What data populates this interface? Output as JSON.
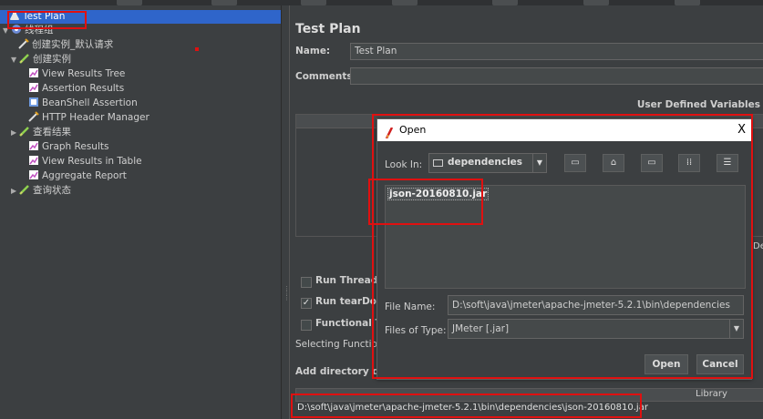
{
  "tree": {
    "items": [
      {
        "label": "Test Plan",
        "icon": "flask-icon"
      },
      {
        "label": "线程组",
        "icon": "gear-icon"
      },
      {
        "label": "创建实例_默认请求",
        "icon": "wrench-icon"
      },
      {
        "label": "创建实例",
        "icon": "pen-icon"
      },
      {
        "label": "View Results Tree",
        "icon": "chart-icon"
      },
      {
        "label": "Assertion Results",
        "icon": "chart-icon"
      },
      {
        "label": "BeanShell Assertion",
        "icon": "assert-icon"
      },
      {
        "label": "HTTP Header Manager",
        "icon": "wrench-icon"
      },
      {
        "label": "查看结果",
        "icon": "pen-icon"
      },
      {
        "label": "Graph Results",
        "icon": "chart-icon"
      },
      {
        "label": "View Results in Table",
        "icon": "chart-icon"
      },
      {
        "label": "Aggregate Report",
        "icon": "chart-icon"
      },
      {
        "label": "查询状态",
        "icon": "pen-icon"
      }
    ]
  },
  "panel": {
    "title": "Test Plan",
    "name_label": "Name:",
    "name_value": "Test Plan",
    "comments_label": "Comments:",
    "udv_label": "User Defined Variables",
    "run_thread_label": "Run Thread G",
    "run_teardown_label": "Run tearDown",
    "functional_label": "Functional Tes",
    "selecting_label": "Selecting Functiona",
    "add_dir_label": "Add directory or ja",
    "library_header": "Library",
    "classpath_entry": "D:\\soft\\java\\jmeter\\apache-jmeter-5.2.1\\bin\\dependencies\\json-20160810.jar",
    "partial_button": "De"
  },
  "dialog": {
    "title": "Open",
    "look_in_label": "Look In:",
    "look_in_value": "dependencies",
    "file_item": "json-20160810.jar",
    "file_name_label": "File Name:",
    "file_name_value": "D:\\soft\\java\\jmeter\\apache-jmeter-5.2.1\\bin\\dependencies",
    "file_type_label": "Files of Type:",
    "file_type_value": "JMeter [.jar]",
    "open_label": "Open",
    "cancel_label": "Cancel",
    "close_glyph": "X"
  },
  "colors": {
    "background": "#3c3f41",
    "selection": "#2f65ca",
    "highlight_red": "#e01010"
  }
}
